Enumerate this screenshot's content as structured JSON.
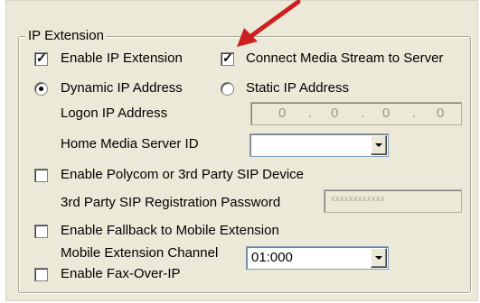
{
  "group": {
    "title": "IP Extension"
  },
  "enable_ip_extension": {
    "label": "Enable IP Extension",
    "checked": true
  },
  "connect_media_stream": {
    "label": "Connect Media Stream to Server",
    "checked": true
  },
  "ip_mode": {
    "dynamic_label": "Dynamic IP Address",
    "static_label": "Static IP Address",
    "selected": "dynamic"
  },
  "logon_ip": {
    "label": "Logon IP Address",
    "octets": [
      "0",
      "0",
      "0",
      "0"
    ],
    "separator": "."
  },
  "home_media_server": {
    "label": "Home Media Server ID",
    "value": ""
  },
  "enable_polycom": {
    "label": "Enable Polycom or 3rd Party SIP Device",
    "checked": false
  },
  "sip_password": {
    "label": "3rd Party SIP Registration Password",
    "masked_value": "xxxxxxxxxxxx"
  },
  "enable_fallback": {
    "label": "Enable Fallback to Mobile Extension",
    "checked": false
  },
  "mobile_channel": {
    "label": "Mobile Extension Channel",
    "value": "01:000"
  },
  "enable_fax": {
    "label": "Enable Fax-Over-IP",
    "checked": false
  },
  "annotation": {
    "arrow_color": "#cc1f1f"
  }
}
